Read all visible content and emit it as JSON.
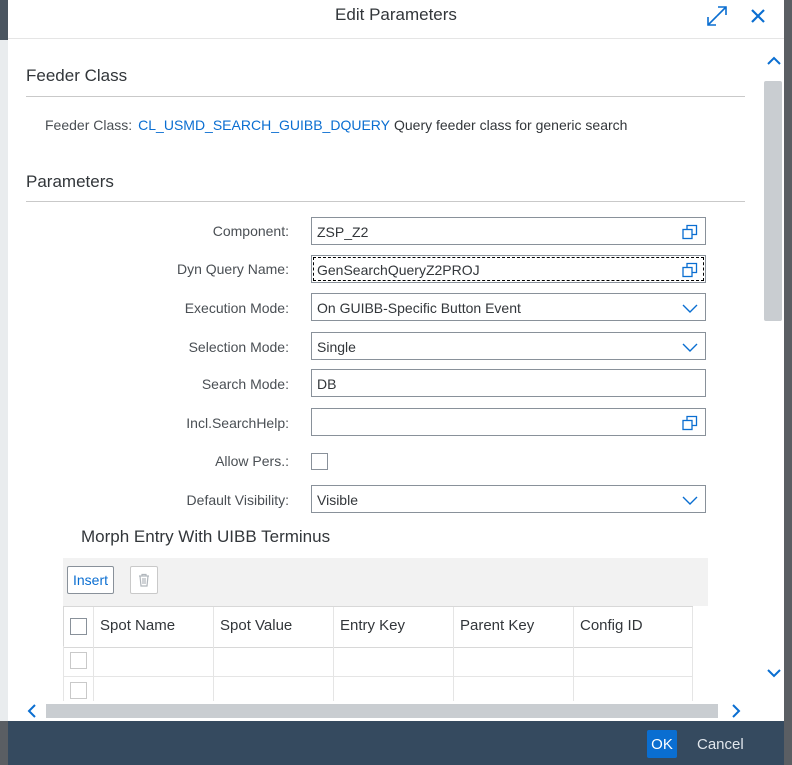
{
  "dialog": {
    "title": "Edit Parameters",
    "maximize_icon": "maximize-icon",
    "close_icon": "close-icon"
  },
  "feeder_section": {
    "title": "Feeder Class",
    "label": "Feeder Class:",
    "class_name": "CL_USMD_SEARCH_GUIBB_DQUERY",
    "description": "Query feeder class for generic search"
  },
  "parameters_section": {
    "title": "Parameters",
    "fields": {
      "component": {
        "label": "Component:",
        "value": "ZSP_Z2",
        "icon": "value-help-icon"
      },
      "dyn_query_name": {
        "label": "Dyn Query Name:",
        "value": "GenSearchQueryZ2PROJ",
        "icon": "value-help-icon"
      },
      "execution_mode": {
        "label": "Execution Mode:",
        "value": "On GUIBB-Specific Button Event",
        "icon": "chevron-down-icon"
      },
      "selection_mode": {
        "label": "Selection Mode:",
        "value": "Single",
        "icon": "chevron-down-icon"
      },
      "search_mode": {
        "label": "Search Mode:",
        "value": "DB"
      },
      "incl_search_help": {
        "label": "Incl.SearchHelp:",
        "value": "",
        "icon": "value-help-icon"
      },
      "allow_pers": {
        "label": "Allow Pers.:",
        "checked": false
      },
      "default_visibility": {
        "label": "Default Visibility:",
        "value": "Visible",
        "icon": "chevron-down-icon"
      }
    }
  },
  "morph_section": {
    "title": "Morph Entry With UIBB Terminus",
    "insert_label": "Insert",
    "delete_icon": "trash-icon",
    "columns": [
      "Spot Name",
      "Spot Value",
      "Entry Key",
      "Parent Key",
      "Config ID"
    ],
    "rows": [
      [
        "",
        "",
        "",
        "",
        ""
      ],
      [
        "",
        "",
        "",
        "",
        ""
      ]
    ]
  },
  "footer": {
    "ok_label": "OK",
    "cancel_label": "Cancel"
  },
  "colors": {
    "link": "#0a6ed1",
    "footer_bg": "#354a5f",
    "primary_button": "#0a6ed1"
  }
}
